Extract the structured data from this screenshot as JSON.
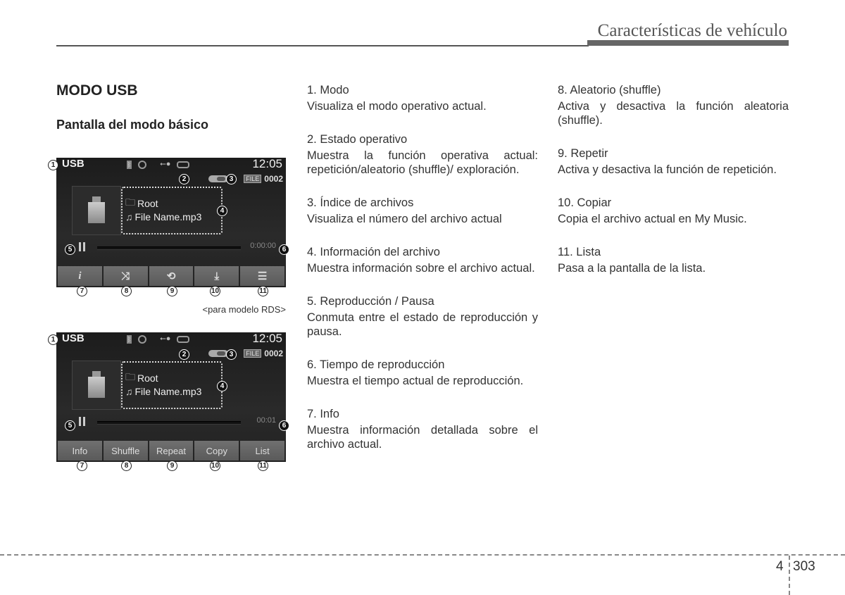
{
  "header": {
    "title": "Características de vehículo"
  },
  "section": {
    "title": "MODO USB",
    "subtitle": "Pantalla del modo básico"
  },
  "screens": [
    {
      "mode": "USB",
      "clock": "12:05",
      "status_icons": [
        "bluetooth-icon",
        "disc-icon",
        "usb-icon",
        "battery-icon"
      ],
      "file_tag": "FILE",
      "file_index": "0002",
      "folder": "Root",
      "file_name": "File Name.mp3",
      "time": "0:00:00",
      "buttons": [
        {
          "name": "info",
          "icon": "i",
          "label": ""
        },
        {
          "name": "shuffle",
          "icon": "⤨",
          "label": ""
        },
        {
          "name": "repeat",
          "icon": "⟲",
          "label": ""
        },
        {
          "name": "copy",
          "icon": "⤓",
          "label": ""
        },
        {
          "name": "list",
          "icon": "☰",
          "label": ""
        }
      ],
      "caption": "<para modelo RDS>"
    },
    {
      "mode": "USB",
      "clock": "12:05",
      "status_icons": [
        "bluetooth-icon",
        "disc-icon",
        "usb-icon",
        "battery-icon"
      ],
      "file_tag": "FILE",
      "file_index": "0002",
      "folder": "Root",
      "file_name": "File Name.mp3",
      "time": "00:01",
      "buttons": [
        {
          "name": "info",
          "label": "Info"
        },
        {
          "name": "shuffle",
          "label": "Shuffle"
        },
        {
          "name": "repeat",
          "label": "Repeat"
        },
        {
          "name": "copy",
          "label": "Copy"
        },
        {
          "name": "list",
          "label": "List"
        }
      ]
    }
  ],
  "callouts": [
    "1",
    "2",
    "3",
    "4",
    "5",
    "6",
    "7",
    "8",
    "9",
    "10",
    "11"
  ],
  "items_left": [
    {
      "heading": "1. Modo",
      "desc": "Visualiza el modo operativo actual."
    },
    {
      "heading": "2. Estado operativo",
      "desc": "Muestra la función operativa actual: repetición/aleatorio (shuffle)/ exploración."
    },
    {
      "heading": "3. Índice de archivos",
      "desc": "Visualiza el número del archivo actual"
    },
    {
      "heading": "4. Información del archivo",
      "desc": "Muestra información sobre el archivo actual."
    },
    {
      "heading": "5. Reproducción / Pausa",
      "desc": "Conmuta entre el estado de reproducción y pausa."
    },
    {
      "heading": "6. Tiempo de reproducción",
      "desc": "Muestra el tiempo actual de reproducción."
    },
    {
      "heading": "7. Info",
      "desc": "Muestra información detallada sobre el archivo actual."
    }
  ],
  "items_right": [
    {
      "heading": "8. Aleatorio (shuffle)",
      "desc": "Activa y desactiva la función aleatoria (shuffle)."
    },
    {
      "heading": "9. Repetir",
      "desc": "Activa y desactiva la función de repetición."
    },
    {
      "heading": "10. Copiar",
      "desc": "Copia el archivo actual en My Music."
    },
    {
      "heading": "11. Lista",
      "desc": "Pasa a la pantalla de la lista."
    }
  ],
  "footer": {
    "chapter": "4",
    "page": "303"
  }
}
